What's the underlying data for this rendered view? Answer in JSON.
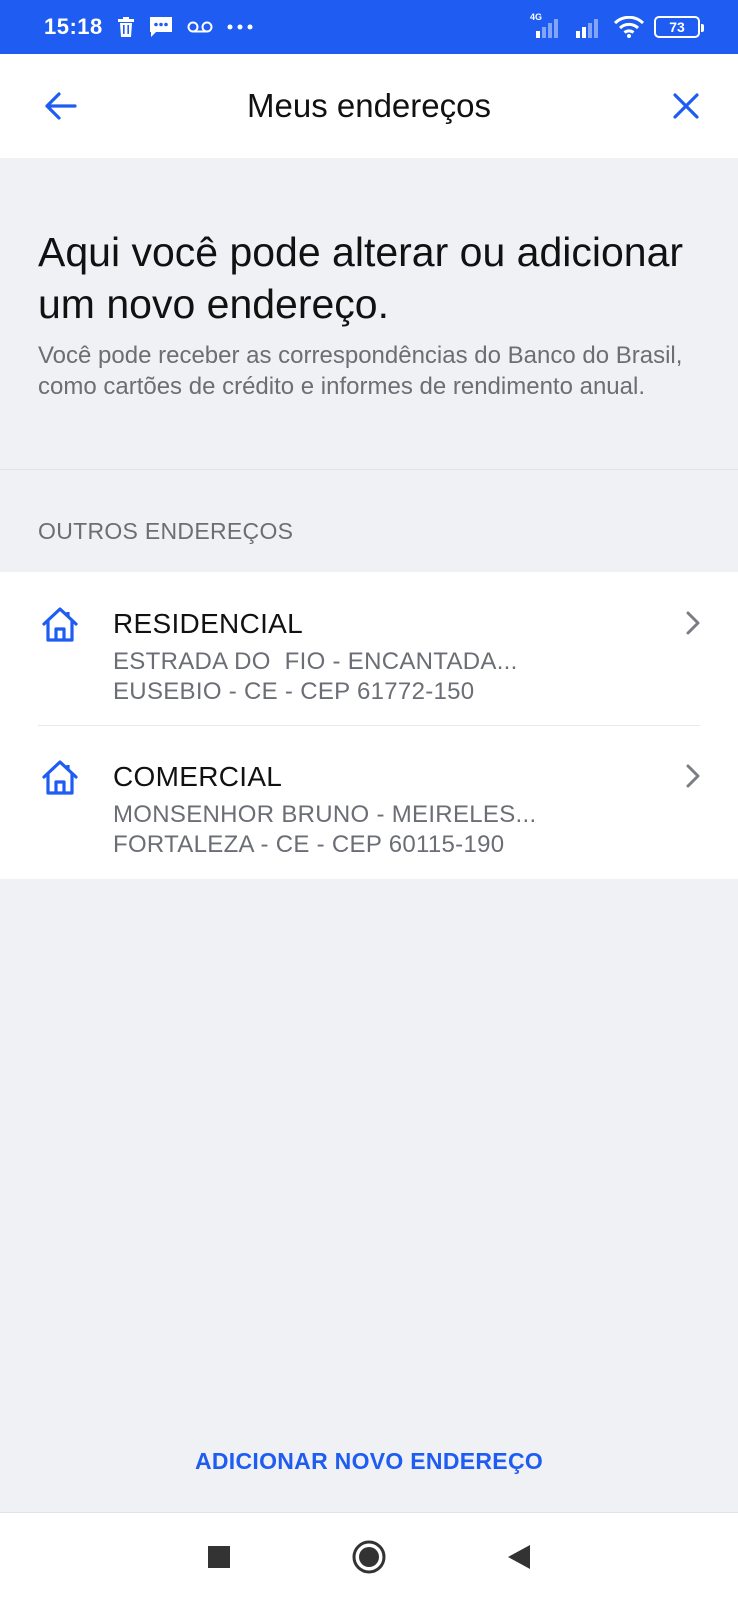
{
  "status_bar": {
    "time": "15:18",
    "network_label": "4G",
    "battery": "73",
    "icons": [
      "trash-icon",
      "message-icon",
      "voicemail-icon",
      "more-dots-icon",
      "signal-4g-icon",
      "signal-icon",
      "wifi-icon",
      "battery-icon"
    ]
  },
  "header": {
    "title": "Meus endereços",
    "back_icon": "arrow-left-icon",
    "close_icon": "close-icon"
  },
  "intro": {
    "heading": "Aqui você pode alterar ou adicionar um novo endereço.",
    "description": "Você pode receber as correspondências do Banco do Brasil, como cartões de crédito e informes de rendimento anual."
  },
  "section": {
    "label": "OUTROS ENDEREÇOS"
  },
  "addresses": [
    {
      "type": "RESIDENCIAL",
      "line1": "ESTRADA DO  FIO - ENCANTADA...",
      "line2": "EUSEBIO - CE - CEP 61772-150",
      "icon": "house-icon"
    },
    {
      "type": "COMERCIAL",
      "line1": "MONSENHOR BRUNO - MEIRELES...",
      "line2": "FORTALEZA - CE - CEP 60115-190",
      "icon": "house-icon"
    }
  ],
  "actions": {
    "add_address": "ADICIONAR NOVO ENDEREÇO"
  },
  "colors": {
    "accent": "#1e5cf2",
    "background": "#f0f1f4",
    "text_primary": "#111111",
    "text_secondary": "#6b6e75"
  }
}
